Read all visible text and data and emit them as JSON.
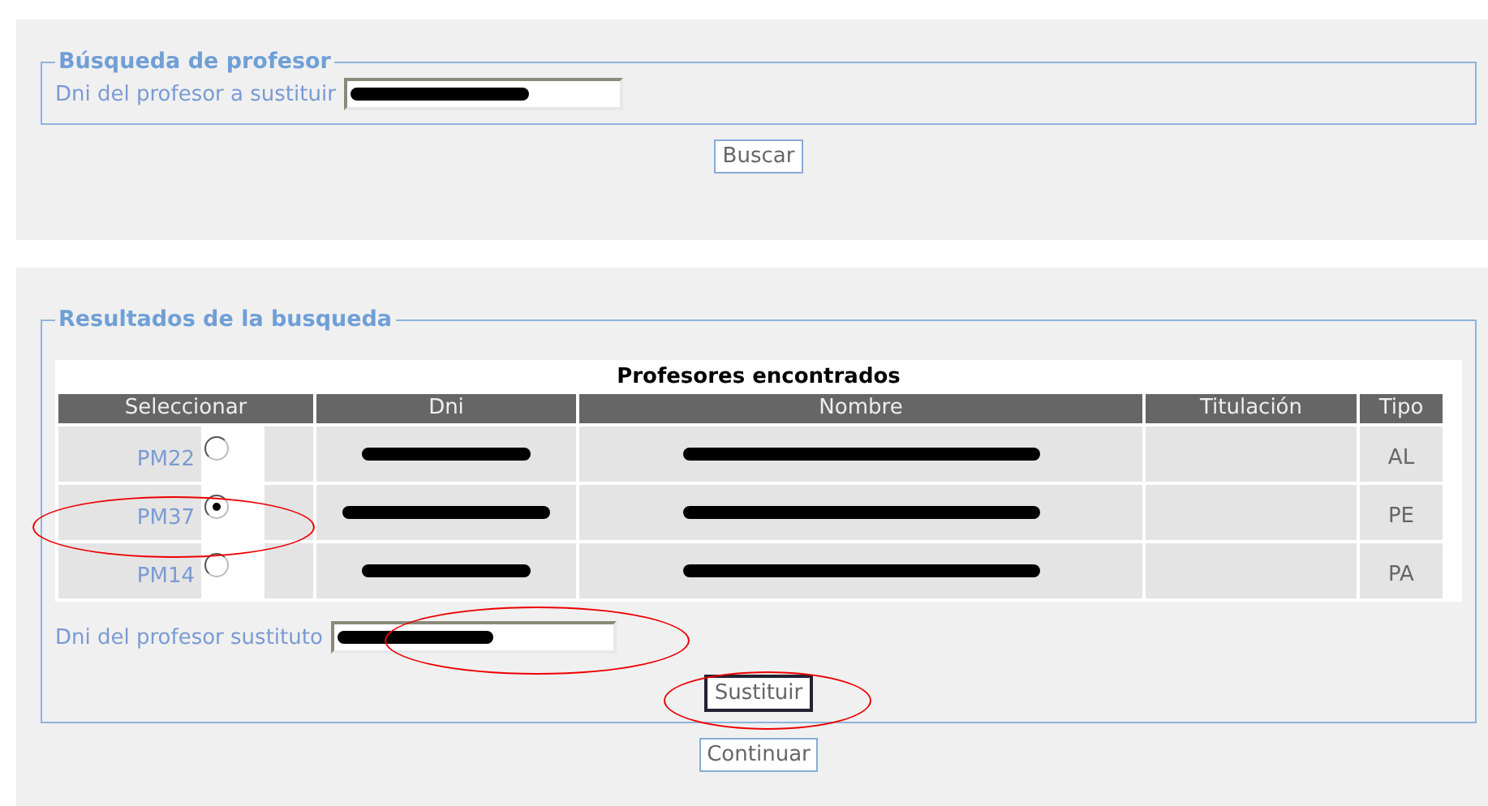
{
  "search_panel": {
    "legend": "Búsqueda de profesor",
    "field_label": "Dni del profesor a sustituir",
    "value_redacted": true,
    "button": "Buscar"
  },
  "results_panel": {
    "legend": "Resultados de la busqueda",
    "table": {
      "caption": "Profesores encontrados",
      "columns": [
        "Seleccionar",
        "Dni",
        "Nombre",
        "Titulación",
        "Tipo"
      ],
      "rows": [
        {
          "code": "PM22",
          "selected": false,
          "dni_redacted": true,
          "name_redacted": true,
          "tipo": "AL"
        },
        {
          "code": "PM37",
          "selected": true,
          "dni_redacted": true,
          "name_redacted": true,
          "tipo": "PE"
        },
        {
          "code": "PM14",
          "selected": false,
          "dni_redacted": true,
          "name_redacted": true,
          "tipo": "PA"
        }
      ]
    },
    "field_label": "Dni del profesor sustituto",
    "value_redacted": true,
    "button": "Sustituir"
  },
  "continue_button": "Continuar"
}
